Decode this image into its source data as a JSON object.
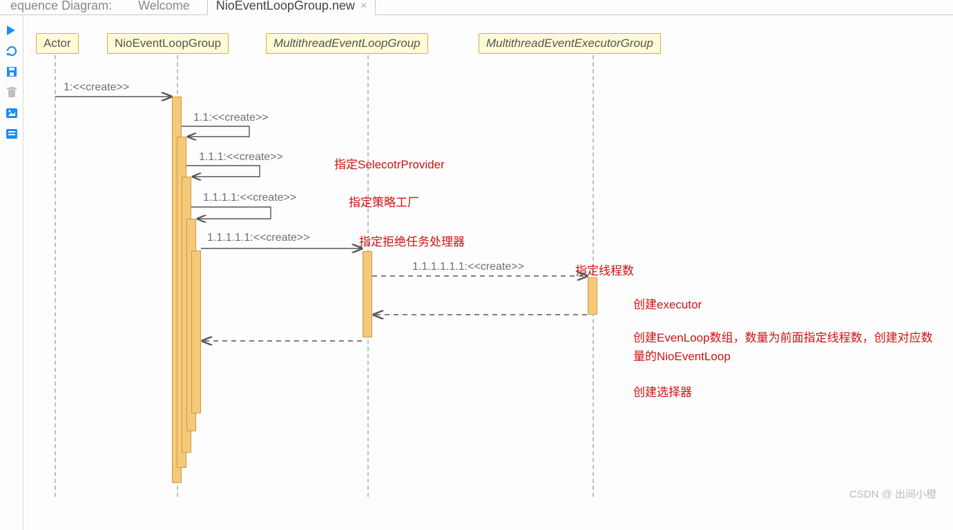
{
  "tabs": {
    "t0": "equence Diagram:",
    "t1": "Welcome",
    "t2": "NioEventLoopGroup.new"
  },
  "participants": {
    "actor": "Actor",
    "nio": "NioEventLoopGroup",
    "multiELG": "MultithreadEventLoopGroup",
    "multiEEG": "MultithreadEventExecutorGroup"
  },
  "messages": {
    "m1": "1:<<create>>",
    "m11": "1.1:<<create>>",
    "m111": "1.1.1:<<create>>",
    "m1111": "1.1.1.1:<<create>>",
    "m11111": "1.1.1.1.1:<<create>>",
    "m111111": "1.1.1.1.1.1:<<create>>"
  },
  "annotations": {
    "a1": "指定SelecotrProvider",
    "a2": "指定策略工厂",
    "a3": "指定拒绝任务处理器",
    "a4": "指定线程数",
    "a5": "创建executor",
    "a6": "创建EvenLoop数组，数量为前面指定线程数，创建对应数量的NioEventLoop",
    "a7": "创建选择器"
  },
  "watermark": "CSDN @ 出间小橙",
  "chart_data": {
    "type": "sequence-diagram",
    "participants": [
      "Actor",
      "NioEventLoopGroup",
      "MultithreadEventLoopGroup",
      "MultithreadEventExecutorGroup"
    ],
    "messages": [
      {
        "from": "Actor",
        "to": "NioEventLoopGroup",
        "label": "1:<<create>>",
        "style": "solid"
      },
      {
        "from": "NioEventLoopGroup",
        "to": "NioEventLoopGroup",
        "label": "1.1:<<create>>",
        "style": "self"
      },
      {
        "from": "NioEventLoopGroup",
        "to": "NioEventLoopGroup",
        "label": "1.1.1:<<create>>",
        "style": "self",
        "note": "指定SelecotrProvider"
      },
      {
        "from": "NioEventLoopGroup",
        "to": "NioEventLoopGroup",
        "label": "1.1.1.1:<<create>>",
        "style": "self",
        "note": "指定策略工厂"
      },
      {
        "from": "NioEventLoopGroup",
        "to": "MultithreadEventLoopGroup",
        "label": "1.1.1.1.1:<<create>>",
        "style": "solid",
        "note": "指定拒绝任务处理器"
      },
      {
        "from": "MultithreadEventLoopGroup",
        "to": "MultithreadEventExecutorGroup",
        "label": "1.1.1.1.1.1:<<create>>",
        "style": "dashed",
        "note": "指定线程数"
      },
      {
        "from": "MultithreadEventExecutorGroup",
        "to": "MultithreadEventLoopGroup",
        "label": "",
        "style": "dashed-return",
        "note": "创建executor"
      },
      {
        "from": "MultithreadEventLoopGroup",
        "to": "NioEventLoopGroup",
        "label": "",
        "style": "dashed-return",
        "note": "创建EvenLoop数组，数量为前面指定线程数，创建对应数量的NioEventLoop; 创建选择器"
      }
    ]
  }
}
